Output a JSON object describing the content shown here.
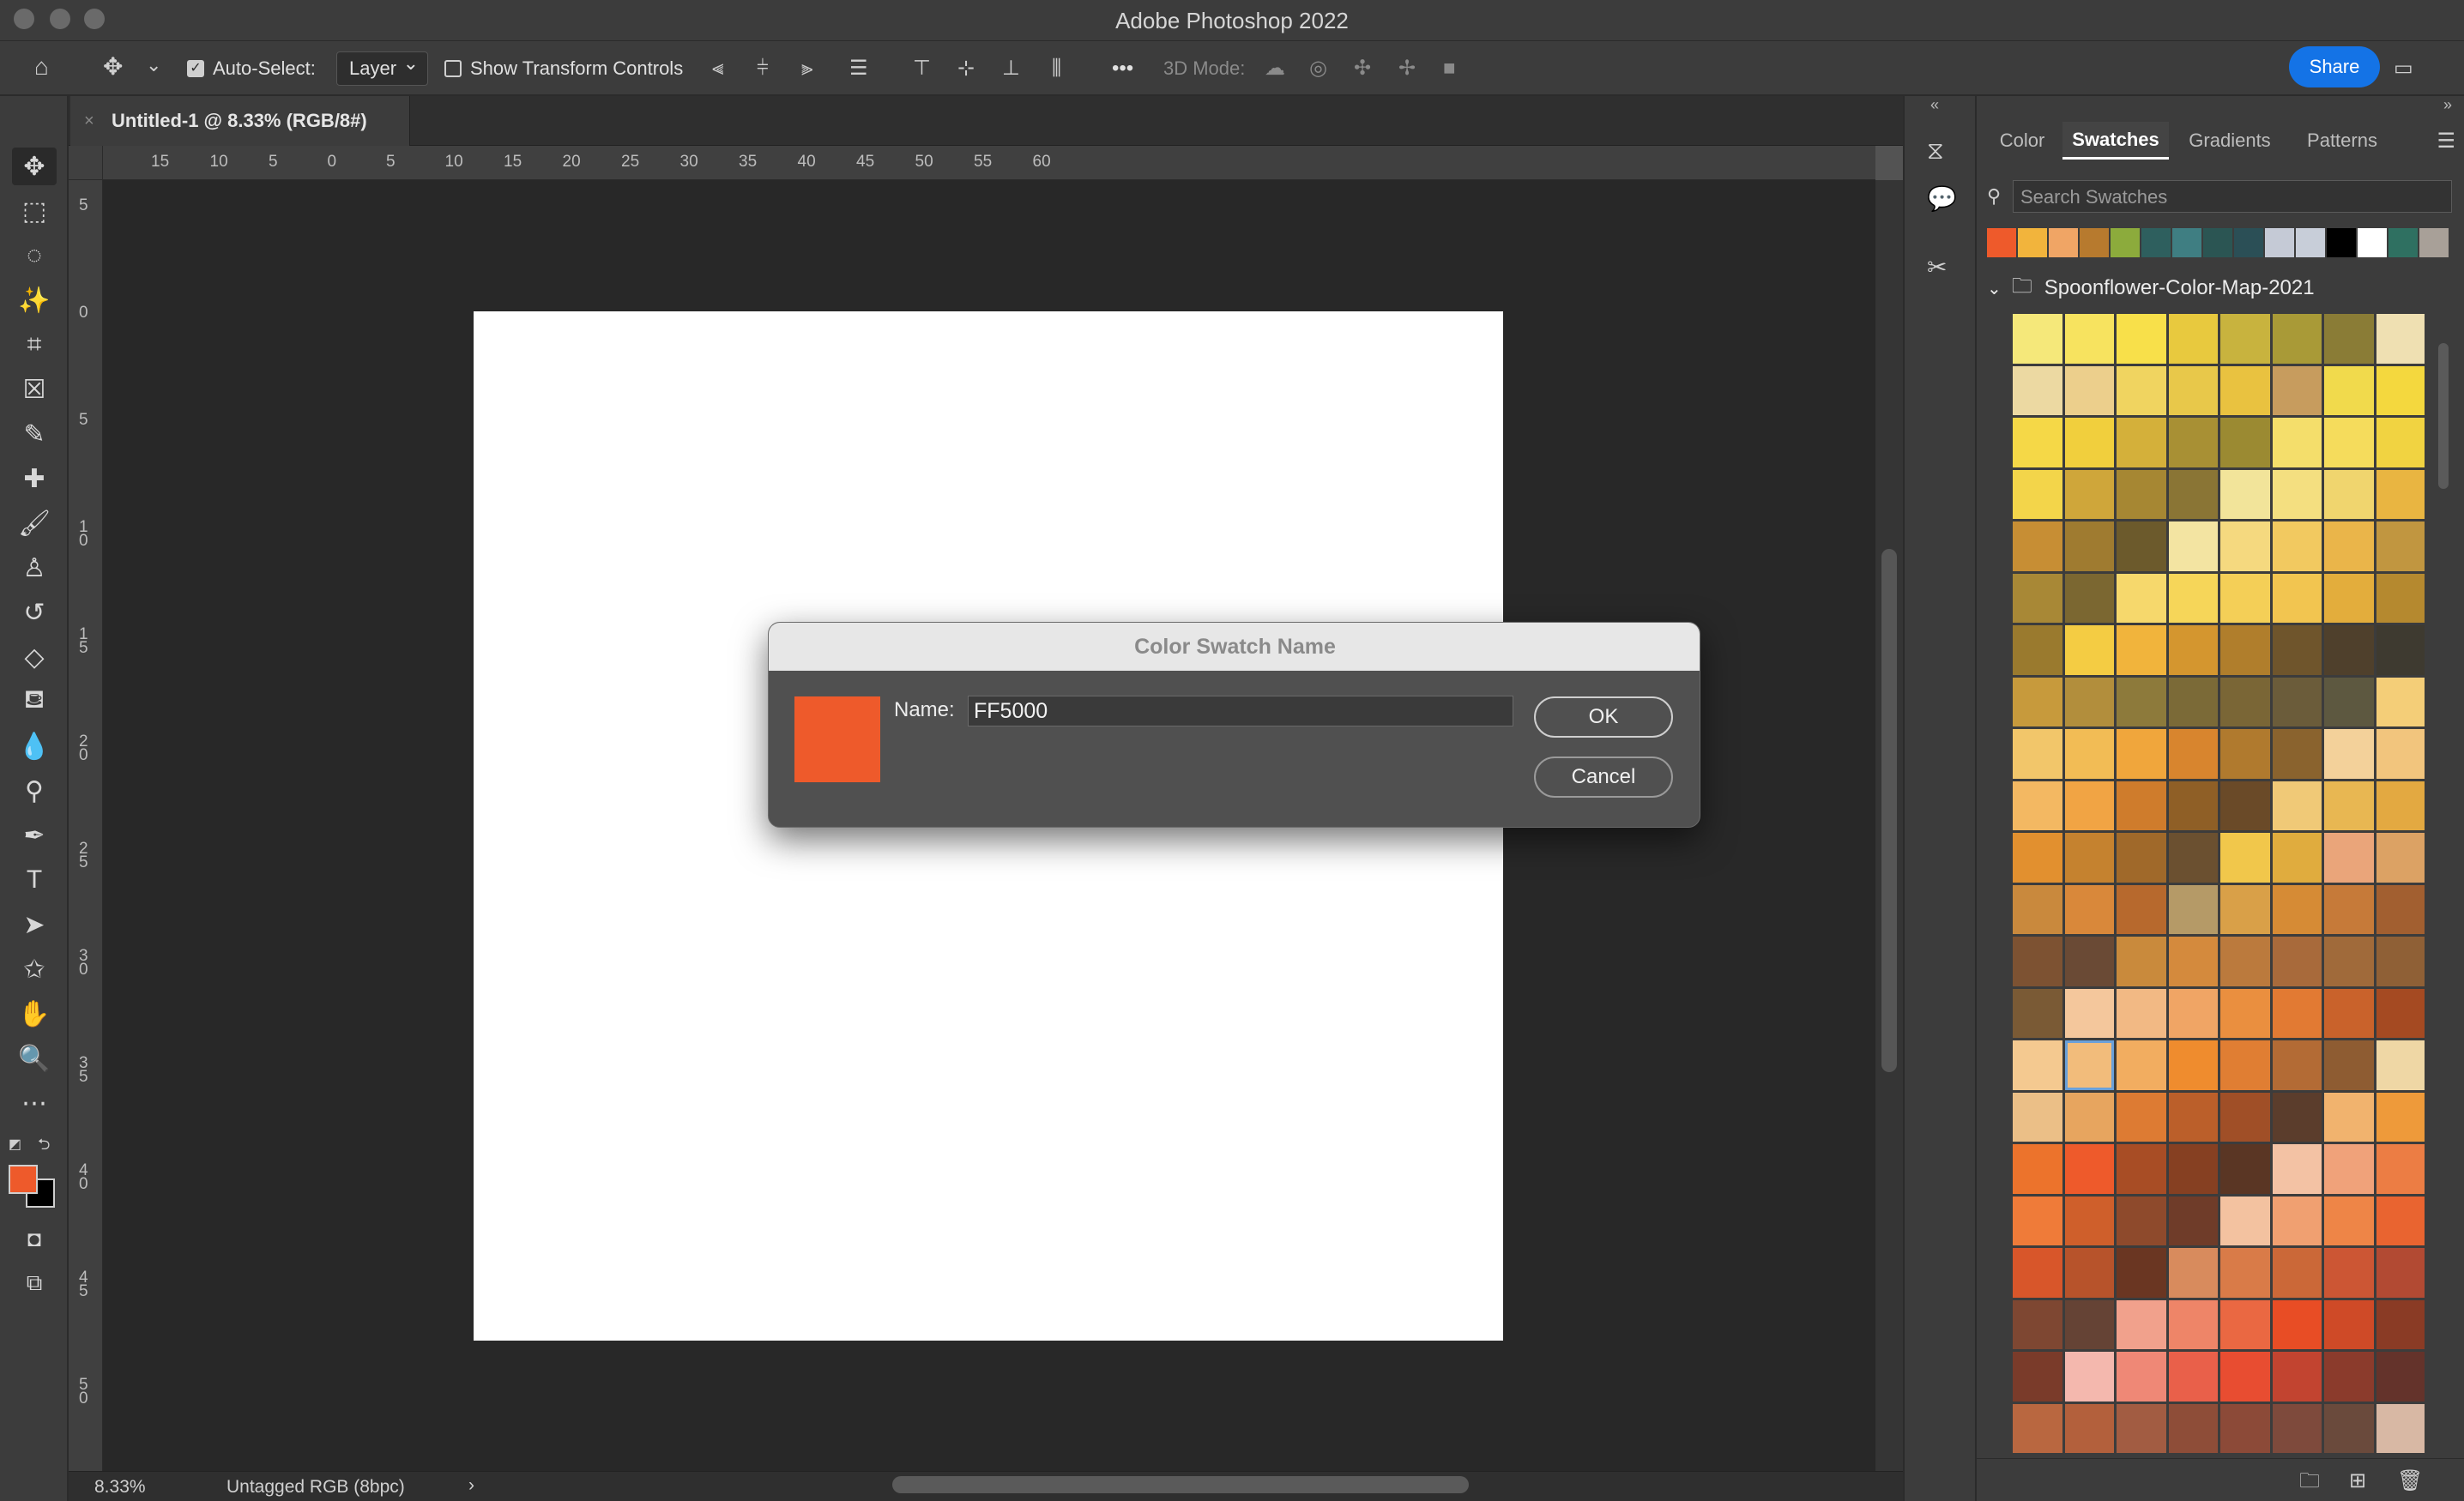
{
  "window": {
    "title": "Adobe Photoshop 2022"
  },
  "options_bar": {
    "auto_select_label": "Auto-Select:",
    "auto_select_checked": true,
    "auto_select_target": "Layer",
    "show_transform_label": "Show Transform Controls",
    "show_transform_checked": false,
    "more_label": "•••",
    "mode_3d_label": "3D Mode:",
    "share_label": "Share"
  },
  "document": {
    "tab_title": "Untitled-1 @ 8.33% (RGB/8#)",
    "close_glyph": "×",
    "zoom": "8.33%",
    "profile": "Untagged RGB (8bpc)",
    "status_arrow": "›"
  },
  "rulers": {
    "top_labels": [
      "15",
      "10",
      "5",
      "0",
      "5",
      "10",
      "15",
      "20",
      "25",
      "30",
      "35",
      "40",
      "45",
      "50",
      "55",
      "60"
    ],
    "left_labels": [
      "5",
      "0",
      "5",
      "10",
      "15",
      "20",
      "25",
      "30",
      "35",
      "40",
      "45",
      "50"
    ]
  },
  "colors": {
    "foreground": "#ee5a2b",
    "background": "#000000"
  },
  "panel": {
    "tabs": [
      "Color",
      "Swatches",
      "Gradients",
      "Patterns"
    ],
    "active_tab": "Swatches",
    "search_placeholder": "Search Swatches",
    "recent_swatches": [
      "#ee5a2b",
      "#f2b43c",
      "#f0a565",
      "#b77a2e",
      "#8cab3c",
      "#2e5f5e",
      "#3f7e82",
      "#2b5553",
      "#2b4f56",
      "#c5cad6",
      "#c8ced9",
      "#000000",
      "#ffffff",
      "#2f7061",
      "#a8a098"
    ],
    "group_name": "Spoonflower-Color-Map-2021",
    "selected_swatch_index": 113,
    "swatch_grid": [
      "#f5e87a",
      "#f7e35f",
      "#f8e04a",
      "#e8c93e",
      "#c8b33e",
      "#a99a37",
      "#8a7c36",
      "#efe0b2",
      "#ecd9a2",
      "#eccf8c",
      "#f0d460",
      "#e8c84a",
      "#e9c240",
      "#c79c5e",
      "#f1da4c",
      "#f4d83e",
      "#f5d847",
      "#f1cf3d",
      "#d4b03a",
      "#a89034",
      "#9b8a32",
      "#f4de6b",
      "#f5dc5c",
      "#f1d341",
      "#f3d54a",
      "#cfa63a",
      "#a68733",
      "#8a7535",
      "#f2e49a",
      "#f4df80",
      "#f0d56e",
      "#e9b541",
      "#c78e34",
      "#9f7b30",
      "#6c5a2c",
      "#f3e4a2",
      "#f5d97f",
      "#f2c960",
      "#eab54a",
      "#c19640",
      "#a88836",
      "#7b6731",
      "#f6d86c",
      "#f6d659",
      "#f4cf57",
      "#f2c550",
      "#e3ad3c",
      "#b5892f",
      "#9a7a2e",
      "#f4cc43",
      "#f1b43c",
      "#d4962f",
      "#b07e2c",
      "#6f552c",
      "#4f402c",
      "#3e3a30",
      "#c79a3c",
      "#b28e3c",
      "#8d7a3b",
      "#7b6a37",
      "#7a6636",
      "#6b5c3a",
      "#5d5840",
      "#f4ce78",
      "#f2c66a",
      "#f2bc55",
      "#f0a63c",
      "#d8852e",
      "#b07a2e",
      "#8a632e",
      "#f3d19a",
      "#f2c57d",
      "#f3b862",
      "#f1a444",
      "#cf7c2c",
      "#8f5f26",
      "#6a4a28",
      "#f0c977",
      "#e8b752",
      "#e3a941",
      "#e2902f",
      "#c5822f",
      "#a0692a",
      "#6b5030",
      "#f1c74b",
      "#e0ac3e",
      "#eaa57a",
      "#dca264",
      "#c9893d",
      "#d9883a",
      "#b7692d",
      "#b59a67",
      "#d9a048",
      "#d68b35",
      "#c67a39",
      "#a25f30",
      "#7d5232",
      "#6a4a35",
      "#c98a3c",
      "#d48a3d",
      "#bb7a3d",
      "#a86a3b",
      "#a06a3a",
      "#8f6036",
      "#7a5a35",
      "#f4c79c",
      "#f2b984",
      "#f0a565",
      "#ea8f3f",
      "#e27a33",
      "#c9622b",
      "#a54a22",
      "#f4c990",
      "#f2bc7b",
      "#f2ad60",
      "#ef8c2e",
      "#e07e33",
      "#b36b35",
      "#8e5c32",
      "#efd7a5",
      "#ebbf87",
      "#e7a55f",
      "#dd7b33",
      "#bb5f2a",
      "#a04f27",
      "#5b3d2c",
      "#f1b36e",
      "#ee9a3a",
      "#ec732c",
      "#ee5a2b",
      "#a84d25",
      "#864022",
      "#5a3624",
      "#f3c2a4",
      "#f0a27a",
      "#ec7d44",
      "#ef7b39",
      "#cf5f2b",
      "#8e4a2c",
      "#6f3c29",
      "#f3c2a0",
      "#f0a071",
      "#ee8547",
      "#e96430",
      "#d8562a",
      "#b7532b",
      "#6a3622",
      "#d88b5d",
      "#d97b48",
      "#cb6838",
      "#cc5634",
      "#b24a33",
      "#7e4732",
      "#654335",
      "#f1a18c",
      "#ee8568",
      "#ea6842",
      "#e84d25",
      "#cf4a27",
      "#8a3b25",
      "#7a3b2a",
      "#f4b8ae",
      "#ef8876",
      "#e9604a",
      "#e84d31",
      "#c24430",
      "#8b3b2c",
      "#64332b",
      "#b96740",
      "#b3603c",
      "#a25c42",
      "#8e4d38",
      "#8c4a38",
      "#7e4a3c",
      "#6a4a3c",
      "#d8b8a4"
    ]
  },
  "dialog": {
    "title": "Color Swatch Name",
    "swatch_color": "#ee5a2b",
    "name_label": "Name:",
    "name_value": "FF5000",
    "ok_label": "OK",
    "cancel_label": "Cancel"
  }
}
